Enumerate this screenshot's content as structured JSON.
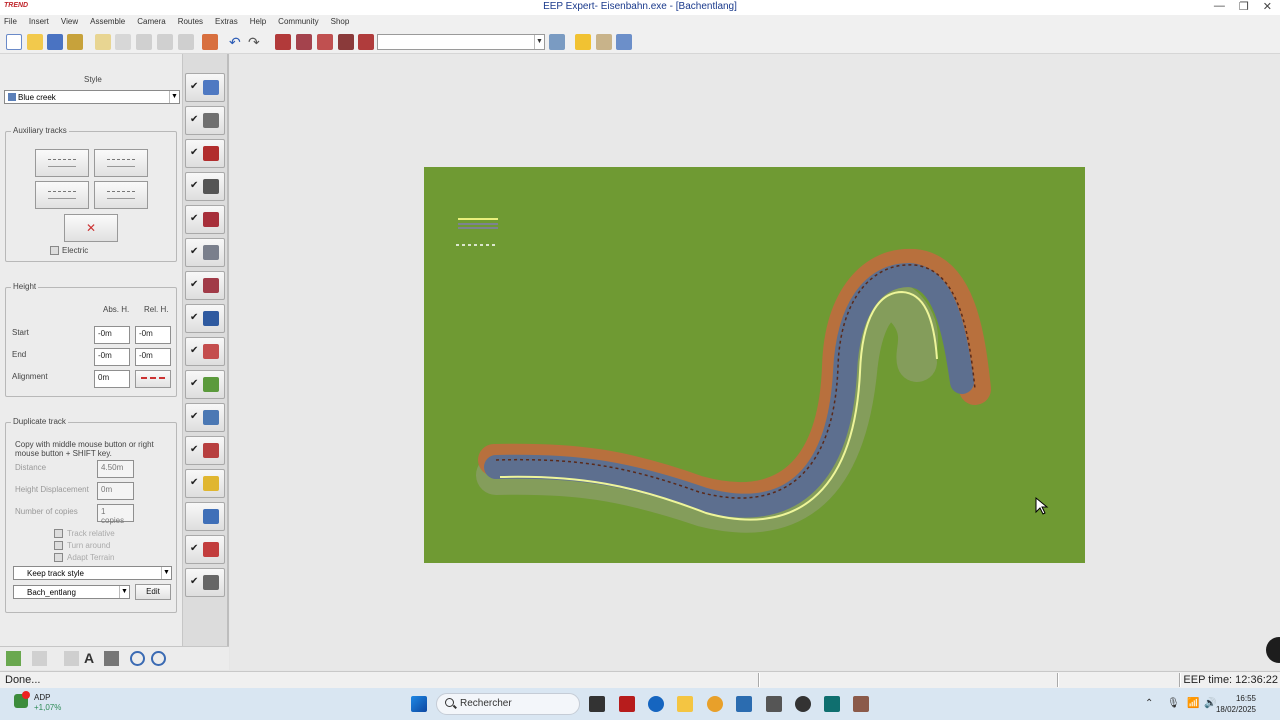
{
  "app": {
    "logo_text": "TREND",
    "window_title": "EEP Expert- Eisenbahn.exe - [Bachentlang]",
    "window_buttons": [
      "—",
      "❐",
      "✕"
    ]
  },
  "menu": [
    "File",
    "Insert",
    "View",
    "Assemble",
    "Camera",
    "Routes",
    "Extras",
    "Help",
    "Community",
    "Shop"
  ],
  "toolbar": {
    "combo_value": "",
    "icons": [
      "new-file-icon",
      "open-folder-icon",
      "save-icon",
      "save-as-icon",
      "copy-icon",
      "paste-icon",
      "cut-icon",
      "duplicate-icon",
      "delete-icon",
      "properties-icon",
      "undo-icon",
      "redo-icon",
      "track-edit-icon",
      "rail-icon",
      "tram-icon",
      "road-icon",
      "water-icon",
      "camera-icon",
      "settings-icon",
      "help-icon"
    ]
  },
  "left_panel": {
    "style_label": "Style",
    "style_value": "Blue creek",
    "auxiliary_tracks_title": "Auxiliary tracks",
    "electric_label": "Electric",
    "height_title": "Height",
    "abs_h_label": "Abs. H.",
    "rel_h_label": "Rel. H.",
    "rows": [
      {
        "label": "Start",
        "abs": "-0m",
        "rel": "-0m"
      },
      {
        "label": "End",
        "abs": "-0m",
        "rel": "-0m"
      },
      {
        "label": "Alignment",
        "abs": "0m",
        "rel": ""
      }
    ],
    "duplicate_title": "Duplicate track",
    "duplicate_hint": "Copy with middle mouse button or right mouse button + SHIFT key.",
    "distance_label": "Distance",
    "distance_value": "4.50m",
    "height_disp_label": "Height Displacement",
    "height_disp_value": "0m",
    "copies_label": "Number of copies",
    "copies_value": "1 copies",
    "track_relative_label": "Track relative",
    "turn_around_label": "Turn around",
    "adapt_terrain_label": "Adapt Terrain",
    "keep_style_value": "Keep track style",
    "track_name_value": "Bach_entlang",
    "edit_label": "Edit"
  },
  "side_column": {
    "icons": [
      "landscape-cube-icon",
      "railway-icon",
      "tram-icon",
      "road-icon",
      "street-icon",
      "water-route-icon",
      "control-icon",
      "people-icon",
      "tree-icon",
      "terrain-icon",
      "landscape-icon",
      "signal-icon",
      "goods-icon",
      "water-icon",
      "river-icon",
      "track-splines-icon"
    ]
  },
  "status": {
    "text": "Done...",
    "eep_time": "EEP time: 12:36:22"
  },
  "taskbar": {
    "widget_name": "ADP",
    "widget_change": "+1,07%",
    "search_placeholder": "Rechercher",
    "time": "16:55",
    "date": "18/02/2025"
  },
  "colors": {
    "grass": "#6f9a33",
    "river": "#5d6f8f",
    "bank": "#b8703d",
    "track_line": "#eef59a"
  }
}
